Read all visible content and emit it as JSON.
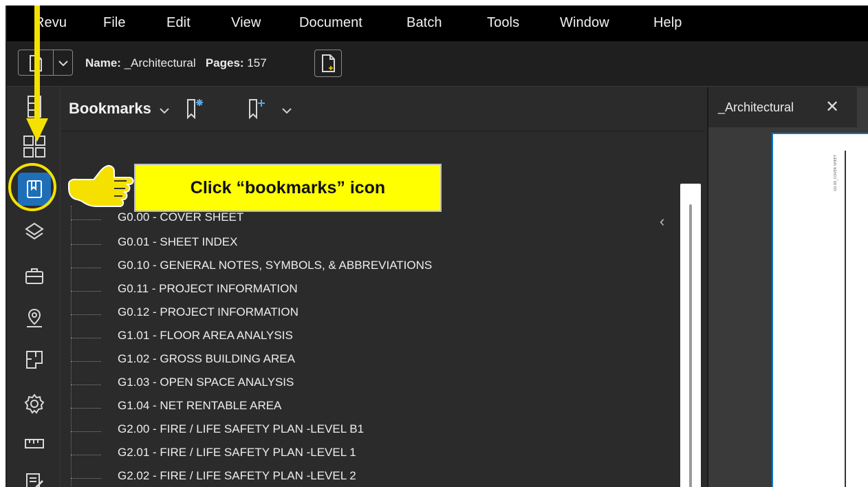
{
  "menubar": {
    "items": [
      "Revu",
      "File",
      "Edit",
      "View",
      "Document",
      "Batch",
      "Tools",
      "Window",
      "Help"
    ]
  },
  "toolbar": {
    "name_label": "Name:",
    "name_value": "_Architectural",
    "pages_label": "Pages:",
    "pages_value": "157"
  },
  "panel": {
    "title": "Bookmarks",
    "bookmarks": [
      "G0.00 - COVER SHEET",
      "G0.01 - SHEET INDEX",
      "G0.10 - GENERAL NOTES, SYMBOLS, & ABBREVIATIONS",
      "G0.11 - PROJECT INFORMATION",
      "G0.12 - PROJECT INFORMATION",
      "G1.01 - FLOOR AREA ANALYSIS",
      "G1.02 - GROSS BUILDING AREA",
      "G1.03 - OPEN SPACE ANALYSIS",
      "G1.04 - NET RENTABLE AREA",
      "G2.00 - FIRE / LIFE SAFETY PLAN -LEVEL B1",
      "G2.01 - FIRE / LIFE SAFETY PLAN -LEVEL 1",
      "G2.02 - FIRE / LIFE SAFETY PLAN -LEVEL 2"
    ]
  },
  "docpane": {
    "tab_label": "_Architectural",
    "page_title_text": "G0.00_COVER SHEET"
  },
  "annotation": {
    "callout_text": "Click “bookmarks” icon"
  },
  "rail_icons": [
    "thumbnails-icon",
    "grid-icon",
    "bookmarks-icon",
    "layers-icon",
    "toolbox-icon",
    "places-icon",
    "spaces-icon",
    "settings-icon",
    "measure-icon",
    "markups-icon"
  ],
  "colors": {
    "accent": "#1e6fb8",
    "highlight": "#f5e100",
    "callout_bg": "#ffff00"
  }
}
